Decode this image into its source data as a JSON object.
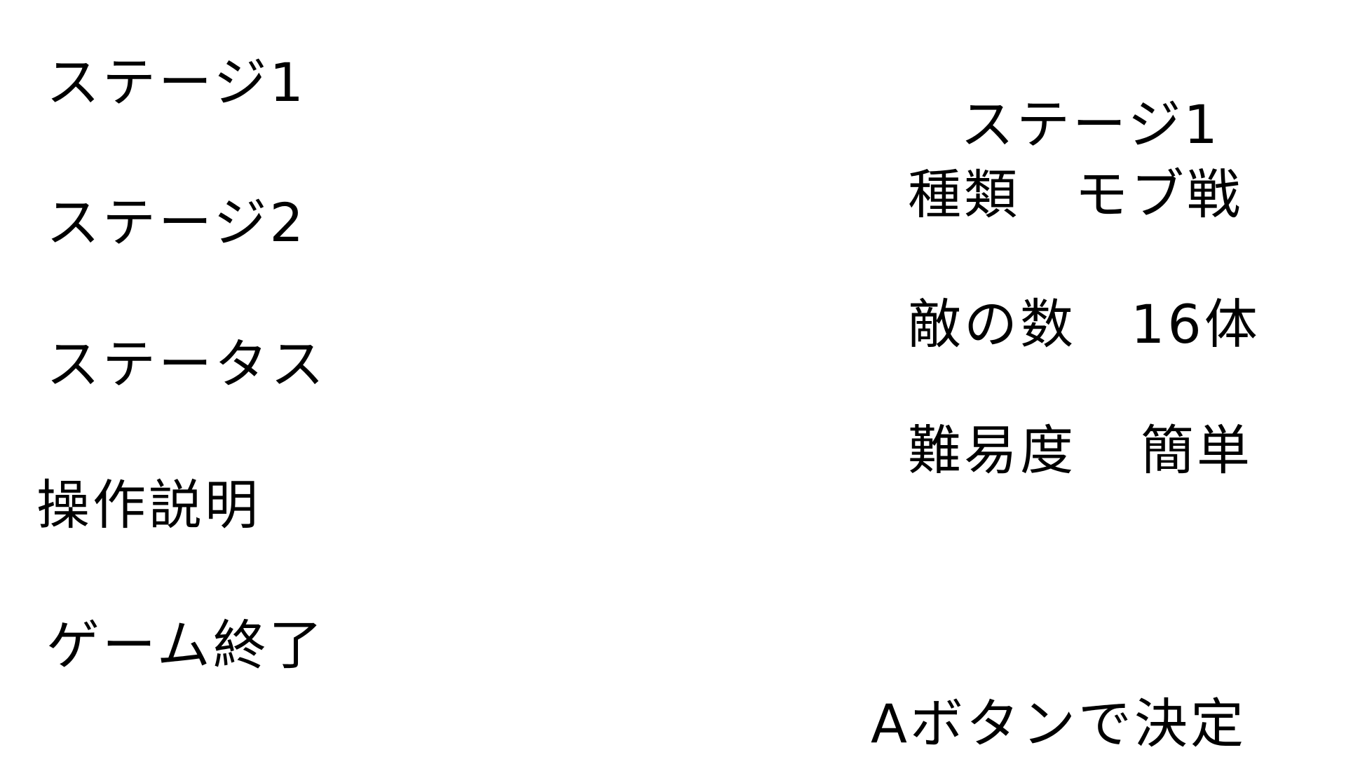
{
  "menu": {
    "items": [
      {
        "label": "ステージ1"
      },
      {
        "label": "ステージ2"
      },
      {
        "label": "ステータス"
      },
      {
        "label": "操作説明"
      },
      {
        "label": "ゲーム終了"
      }
    ],
    "selected": "ステージ1"
  },
  "info": {
    "title": "ステージ1",
    "rows": [
      {
        "label": "種類",
        "value": "モブ戦"
      },
      {
        "label": "敵の数",
        "value": "16体"
      },
      {
        "label": "難易度",
        "value": "簡単"
      }
    ]
  },
  "hint": {
    "confirm": "Aボタンで決定"
  }
}
